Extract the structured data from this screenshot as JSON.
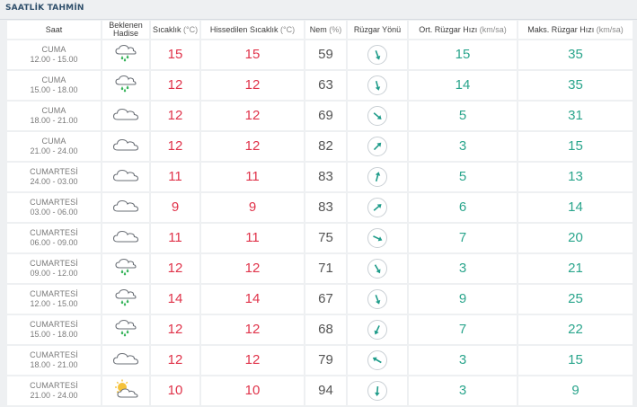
{
  "header": {
    "title": "SAATLİK TAHMİN"
  },
  "columns": {
    "saat": "Saat",
    "hadise": "Beklenen Hadise",
    "sicaklik": "Sıcaklık",
    "sicaklik_unit": "(°C)",
    "hissedilen": "Hissedilen Sıcaklık",
    "hissedilen_unit": "(°C)",
    "nem": "Nem",
    "nem_unit": "(%)",
    "yon": "Rüzgar Yönü",
    "ort": "Ort. Rüzgar Hızı",
    "ort_unit": "(km/sa)",
    "maks": "Maks. Rüzgar Hızı",
    "maks_unit": "(km/sa)"
  },
  "colors": {
    "temp": "#e0334a",
    "speed": "#2aa58c",
    "arrow": "#1f9c8a"
  },
  "rows": [
    {
      "day": "CUMA",
      "time": "12.00 - 15.00",
      "icon": "rain-cloud-icon",
      "temp": "15",
      "feel": "15",
      "hum": "59",
      "wind_deg": 160,
      "avg": "15",
      "max": "35"
    },
    {
      "day": "CUMA",
      "time": "15.00 - 18.00",
      "icon": "rain-cloud-icon",
      "temp": "12",
      "feel": "12",
      "hum": "63",
      "wind_deg": 165,
      "avg": "14",
      "max": "35"
    },
    {
      "day": "CUMA",
      "time": "18.00 - 21.00",
      "icon": "cloud-icon",
      "temp": "12",
      "feel": "12",
      "hum": "69",
      "wind_deg": 130,
      "avg": "5",
      "max": "31"
    },
    {
      "day": "CUMA",
      "time": "21.00 - 24.00",
      "icon": "cloud-icon",
      "temp": "12",
      "feel": "12",
      "hum": "82",
      "wind_deg": 45,
      "avg": "3",
      "max": "15"
    },
    {
      "day": "CUMARTESİ",
      "time": "24.00 - 03.00",
      "icon": "cloud-icon",
      "temp": "11",
      "feel": "11",
      "hum": "83",
      "wind_deg": 15,
      "avg": "5",
      "max": "13"
    },
    {
      "day": "CUMARTESİ",
      "time": "03.00 - 06.00",
      "icon": "cloud-icon",
      "temp": "9",
      "feel": "9",
      "hum": "83",
      "wind_deg": 50,
      "avg": "6",
      "max": "14"
    },
    {
      "day": "CUMARTESİ",
      "time": "06.00 - 09.00",
      "icon": "cloud-icon",
      "temp": "11",
      "feel": "11",
      "hum": "75",
      "wind_deg": 115,
      "avg": "7",
      "max": "20"
    },
    {
      "day": "CUMARTESİ",
      "time": "09.00 - 12.00",
      "icon": "rain-cloud-icon",
      "temp": "12",
      "feel": "12",
      "hum": "71",
      "wind_deg": 150,
      "avg": "3",
      "max": "21"
    },
    {
      "day": "CUMARTESİ",
      "time": "12.00 - 15.00",
      "icon": "rain-cloud-icon",
      "temp": "14",
      "feel": "14",
      "hum": "67",
      "wind_deg": 160,
      "avg": "9",
      "max": "25"
    },
    {
      "day": "CUMARTESİ",
      "time": "15.00 - 18.00",
      "icon": "rain-cloud-icon",
      "temp": "12",
      "feel": "12",
      "hum": "68",
      "wind_deg": 205,
      "avg": "7",
      "max": "22"
    },
    {
      "day": "CUMARTESİ",
      "time": "18.00 - 21.00",
      "icon": "cloud-icon",
      "temp": "12",
      "feel": "12",
      "hum": "79",
      "wind_deg": 300,
      "avg": "3",
      "max": "15"
    },
    {
      "day": "CUMARTESİ",
      "time": "21.00 - 24.00",
      "icon": "partly-sunny-icon",
      "temp": "10",
      "feel": "10",
      "hum": "94",
      "wind_deg": 185,
      "avg": "3",
      "max": "9"
    }
  ]
}
